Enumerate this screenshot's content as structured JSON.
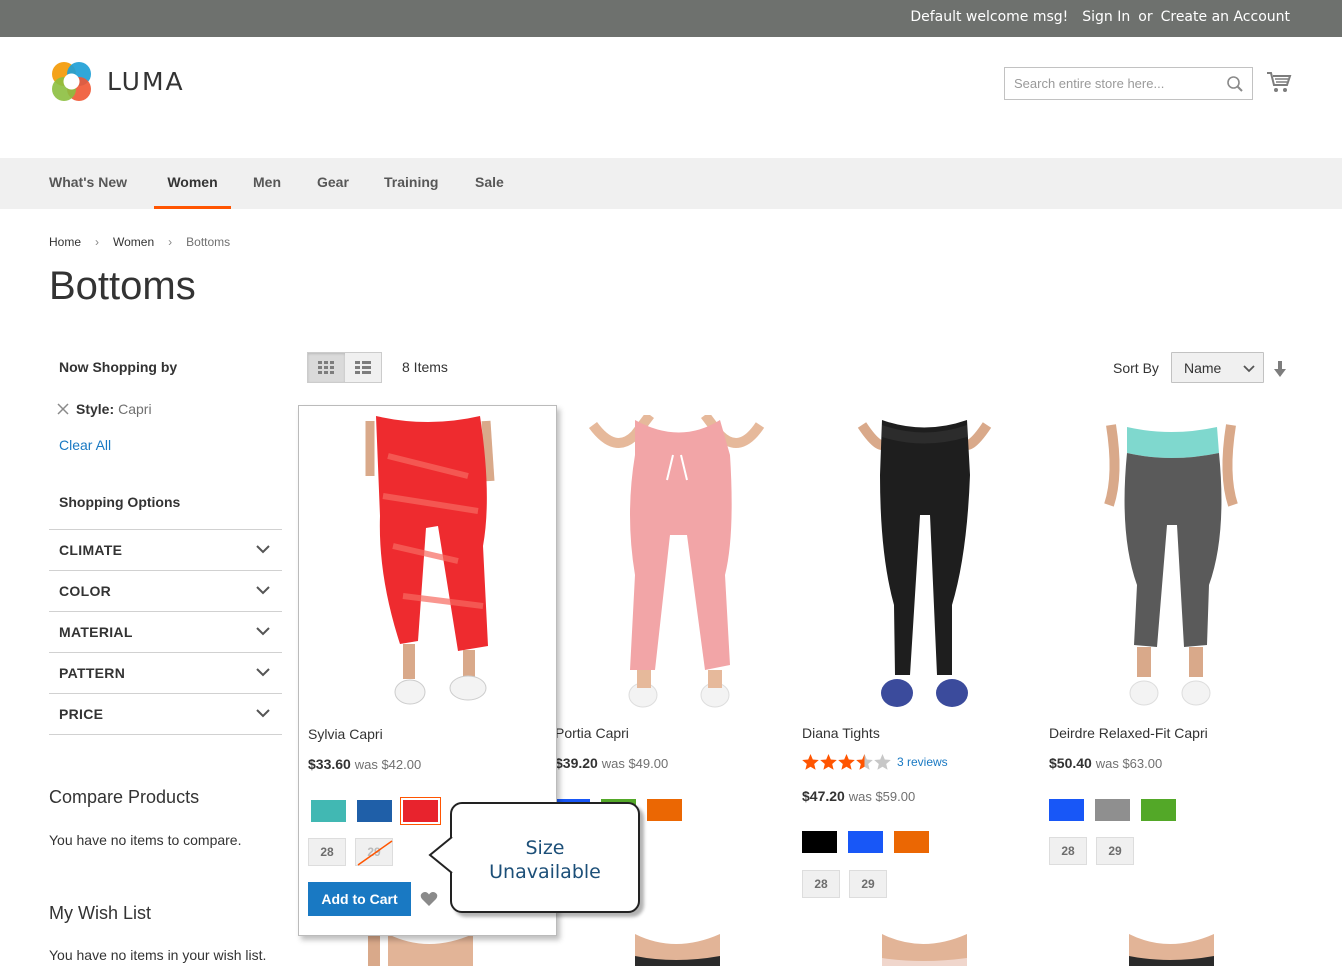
{
  "topbar": {
    "welcome": "Default welcome msg!",
    "sign_in": "Sign In",
    "or": "or",
    "create_account": "Create an Account"
  },
  "logo": {
    "text": "LUMA"
  },
  "search": {
    "placeholder": "Search entire store here..."
  },
  "nav": {
    "items": [
      "What's New",
      "Women",
      "Men",
      "Gear",
      "Training",
      "Sale"
    ],
    "active": "Women"
  },
  "breadcrumb": [
    "Home",
    "Women",
    "Bottoms"
  ],
  "page_title": "Bottoms",
  "sidebar": {
    "now_shopping": "Now Shopping by",
    "filter_label": "Style:",
    "filter_value": "Capri",
    "clear_all": "Clear All",
    "shopping_options": "Shopping Options",
    "facets": [
      "CLIMATE",
      "COLOR",
      "MATERIAL",
      "PATTERN",
      "PRICE"
    ],
    "compare_title": "Compare Products",
    "compare_text": "You have no items to compare.",
    "wish_title": "My Wish List",
    "wish_text": "You have no items in your wish list."
  },
  "toolbar": {
    "count": "8 Items",
    "sort_label": "Sort By",
    "sort_value": "Name"
  },
  "products": [
    {
      "name": "Sylvia Capri",
      "price": "$33.60",
      "was": "was $42.00",
      "swatches": [
        "#41b8b3",
        "#1f5fa8",
        "#e8232d"
      ],
      "sizes": [
        "28",
        "29"
      ],
      "add_to_cart": "Add to Cart"
    },
    {
      "name": "Portia Capri",
      "price": "$39.20",
      "was": "was $49.00",
      "swatches": [
        "#1857f7",
        "#53a828",
        "#eb6703"
      ]
    },
    {
      "name": "Diana Tights",
      "rating": 3.5,
      "reviews": "3 reviews",
      "price": "$47.20",
      "was": "was $59.00",
      "swatches": [
        "#000000",
        "#1857f7",
        "#eb6703"
      ],
      "sizes": [
        "28",
        "29"
      ]
    },
    {
      "name": "Deirdre Relaxed-Fit Capri",
      "price": "$50.40",
      "was": "was $63.00",
      "swatches": [
        "#1857f7",
        "#8f8f8f",
        "#53a828"
      ],
      "sizes": [
        "28",
        "29"
      ]
    }
  ],
  "tooltip": {
    "line1": "Size",
    "line2": "Unavailable"
  },
  "colors": {
    "accent": "#ff5501",
    "link": "#1979c3",
    "topbar": "#6e716e",
    "nav_bg": "#f0f0f0"
  }
}
